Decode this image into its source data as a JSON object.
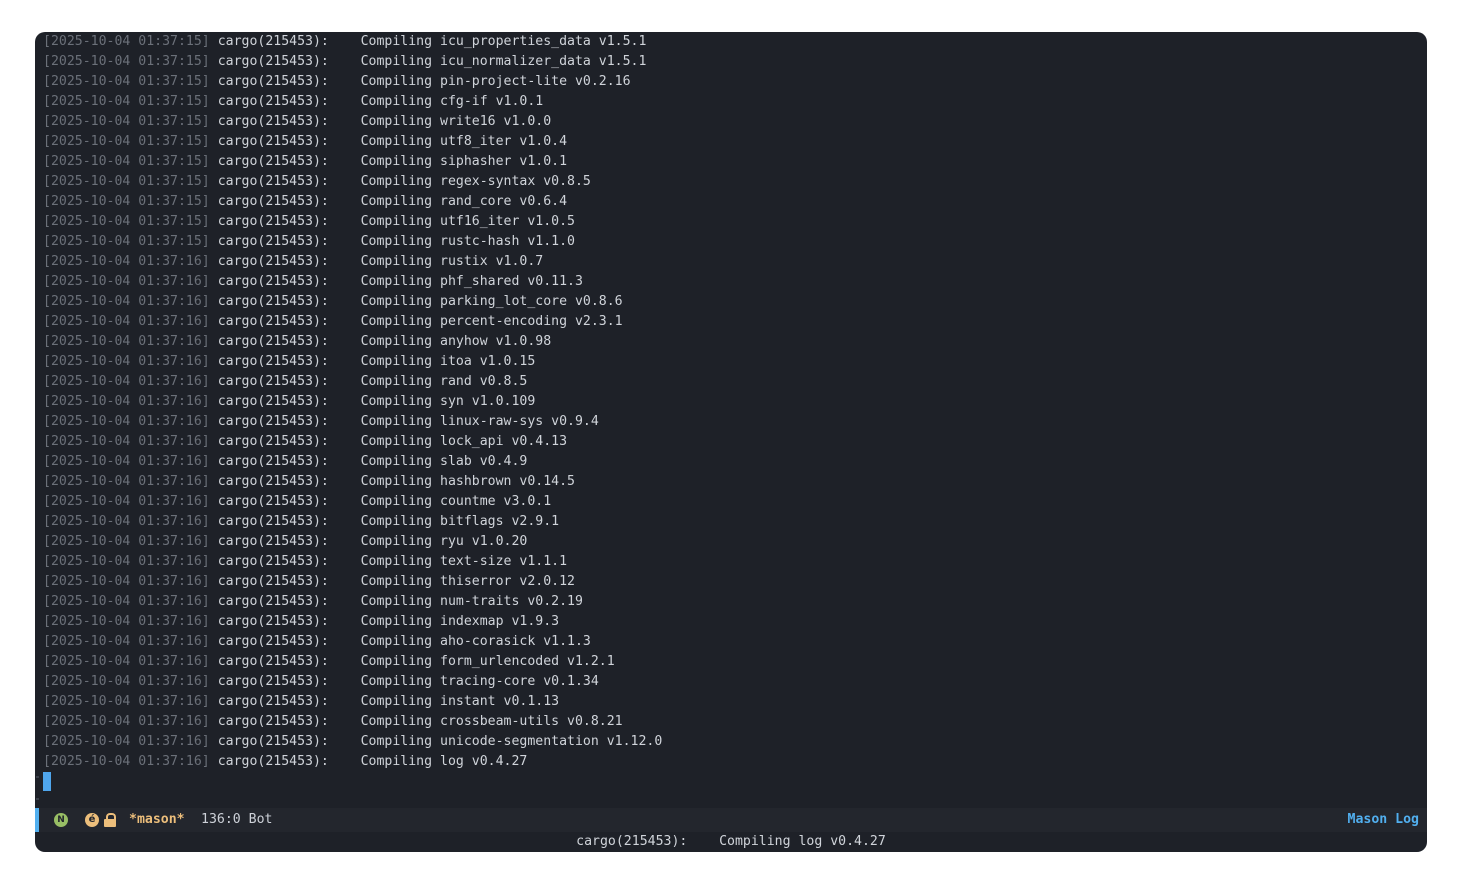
{
  "log": {
    "lines": [
      {
        "ts": "[2025-10-04 01:37:15]",
        "proc": "cargo(215453):",
        "msg": "Compiling icu_properties_data v1.5.1"
      },
      {
        "ts": "[2025-10-04 01:37:15]",
        "proc": "cargo(215453):",
        "msg": "Compiling icu_normalizer_data v1.5.1"
      },
      {
        "ts": "[2025-10-04 01:37:15]",
        "proc": "cargo(215453):",
        "msg": "Compiling pin-project-lite v0.2.16"
      },
      {
        "ts": "[2025-10-04 01:37:15]",
        "proc": "cargo(215453):",
        "msg": "Compiling cfg-if v1.0.1"
      },
      {
        "ts": "[2025-10-04 01:37:15]",
        "proc": "cargo(215453):",
        "msg": "Compiling write16 v1.0.0"
      },
      {
        "ts": "[2025-10-04 01:37:15]",
        "proc": "cargo(215453):",
        "msg": "Compiling utf8_iter v1.0.4"
      },
      {
        "ts": "[2025-10-04 01:37:15]",
        "proc": "cargo(215453):",
        "msg": "Compiling siphasher v1.0.1"
      },
      {
        "ts": "[2025-10-04 01:37:15]",
        "proc": "cargo(215453):",
        "msg": "Compiling regex-syntax v0.8.5"
      },
      {
        "ts": "[2025-10-04 01:37:15]",
        "proc": "cargo(215453):",
        "msg": "Compiling rand_core v0.6.4"
      },
      {
        "ts": "[2025-10-04 01:37:15]",
        "proc": "cargo(215453):",
        "msg": "Compiling utf16_iter v1.0.5"
      },
      {
        "ts": "[2025-10-04 01:37:15]",
        "proc": "cargo(215453):",
        "msg": "Compiling rustc-hash v1.1.0"
      },
      {
        "ts": "[2025-10-04 01:37:16]",
        "proc": "cargo(215453):",
        "msg": "Compiling rustix v1.0.7"
      },
      {
        "ts": "[2025-10-04 01:37:16]",
        "proc": "cargo(215453):",
        "msg": "Compiling phf_shared v0.11.3"
      },
      {
        "ts": "[2025-10-04 01:37:16]",
        "proc": "cargo(215453):",
        "msg": "Compiling parking_lot_core v0.8.6"
      },
      {
        "ts": "[2025-10-04 01:37:16]",
        "proc": "cargo(215453):",
        "msg": "Compiling percent-encoding v2.3.1"
      },
      {
        "ts": "[2025-10-04 01:37:16]",
        "proc": "cargo(215453):",
        "msg": "Compiling anyhow v1.0.98"
      },
      {
        "ts": "[2025-10-04 01:37:16]",
        "proc": "cargo(215453):",
        "msg": "Compiling itoa v1.0.15"
      },
      {
        "ts": "[2025-10-04 01:37:16]",
        "proc": "cargo(215453):",
        "msg": "Compiling rand v0.8.5"
      },
      {
        "ts": "[2025-10-04 01:37:16]",
        "proc": "cargo(215453):",
        "msg": "Compiling syn v1.0.109"
      },
      {
        "ts": "[2025-10-04 01:37:16]",
        "proc": "cargo(215453):",
        "msg": "Compiling linux-raw-sys v0.9.4"
      },
      {
        "ts": "[2025-10-04 01:37:16]",
        "proc": "cargo(215453):",
        "msg": "Compiling lock_api v0.4.13"
      },
      {
        "ts": "[2025-10-04 01:37:16]",
        "proc": "cargo(215453):",
        "msg": "Compiling slab v0.4.9"
      },
      {
        "ts": "[2025-10-04 01:37:16]",
        "proc": "cargo(215453):",
        "msg": "Compiling hashbrown v0.14.5"
      },
      {
        "ts": "[2025-10-04 01:37:16]",
        "proc": "cargo(215453):",
        "msg": "Compiling countme v3.0.1"
      },
      {
        "ts": "[2025-10-04 01:37:16]",
        "proc": "cargo(215453):",
        "msg": "Compiling bitflags v2.9.1"
      },
      {
        "ts": "[2025-10-04 01:37:16]",
        "proc": "cargo(215453):",
        "msg": "Compiling ryu v1.0.20"
      },
      {
        "ts": "[2025-10-04 01:37:16]",
        "proc": "cargo(215453):",
        "msg": "Compiling text-size v1.1.1"
      },
      {
        "ts": "[2025-10-04 01:37:16]",
        "proc": "cargo(215453):",
        "msg": "Compiling thiserror v2.0.12"
      },
      {
        "ts": "[2025-10-04 01:37:16]",
        "proc": "cargo(215453):",
        "msg": "Compiling num-traits v0.2.19"
      },
      {
        "ts": "[2025-10-04 01:37:16]",
        "proc": "cargo(215453):",
        "msg": "Compiling indexmap v1.9.3"
      },
      {
        "ts": "[2025-10-04 01:37:16]",
        "proc": "cargo(215453):",
        "msg": "Compiling aho-corasick v1.1.3"
      },
      {
        "ts": "[2025-10-04 01:37:16]",
        "proc": "cargo(215453):",
        "msg": "Compiling form_urlencoded v1.2.1"
      },
      {
        "ts": "[2025-10-04 01:37:16]",
        "proc": "cargo(215453):",
        "msg": "Compiling tracing-core v0.1.34"
      },
      {
        "ts": "[2025-10-04 01:37:16]",
        "proc": "cargo(215453):",
        "msg": "Compiling instant v0.1.13"
      },
      {
        "ts": "[2025-10-04 01:37:16]",
        "proc": "cargo(215453):",
        "msg": "Compiling crossbeam-utils v0.8.21"
      },
      {
        "ts": "[2025-10-04 01:37:16]",
        "proc": "cargo(215453):",
        "msg": "Compiling unicode-segmentation v1.12.0"
      },
      {
        "ts": "[2025-10-04 01:37:16]",
        "proc": "cargo(215453):",
        "msg": "Compiling log v0.4.27"
      }
    ]
  },
  "modeline": {
    "state_icon": "normal-state-icon",
    "state_letter": "N",
    "encoding_icon": "encoding-icon",
    "encoding_letter": "é",
    "lock_icon": "read-only-lock-icon",
    "buffer_name": "*mason*",
    "position": "136:0 Bot",
    "mode_name": "Mason Log"
  },
  "echo_area": {
    "text": "cargo(215453):    Compiling log v0.4.27"
  },
  "colors": {
    "background": "#1e2128",
    "timestamp": "#6b7079",
    "text": "#d0d4da",
    "accent": "#51afef",
    "buffer_name": "#ecbe7b",
    "state_normal": "#98be65"
  }
}
